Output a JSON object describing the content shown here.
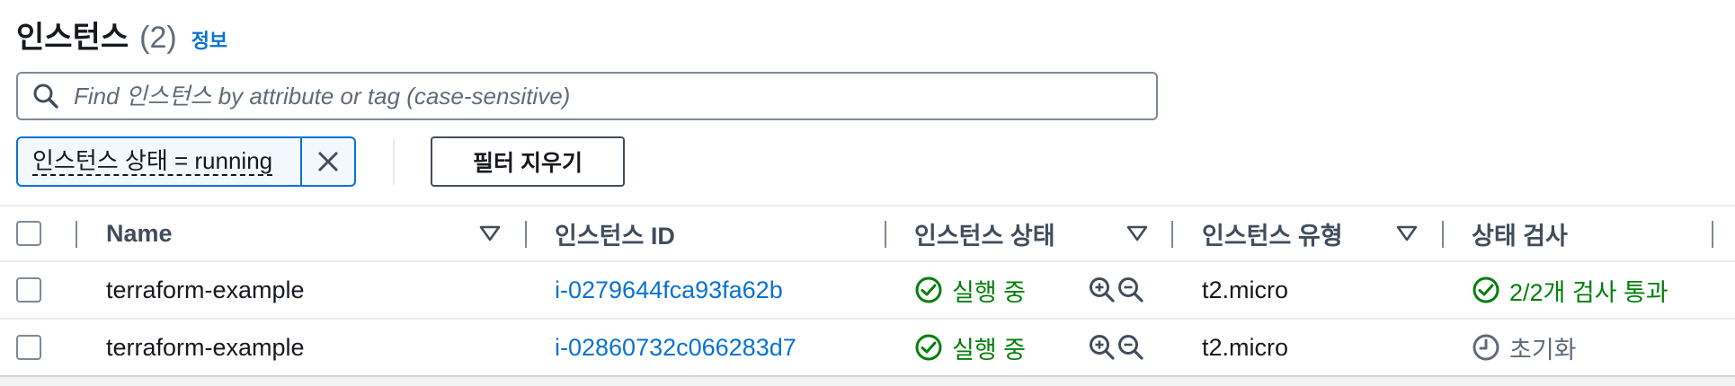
{
  "header": {
    "title": "인스턴스",
    "count": "(2)",
    "info_link": "정보"
  },
  "search": {
    "placeholder": "Find 인스턴스 by attribute or tag (case-sensitive)",
    "value": "",
    "icon": "search-icon"
  },
  "filter": {
    "token_label": "인스턴스 상태 = running",
    "dismiss_icon": "close-icon",
    "clear_button": "필터 지우기"
  },
  "table": {
    "columns": [
      {
        "label": "Name",
        "sortable": true
      },
      {
        "label": "인스턴스 ID",
        "sortable": false
      },
      {
        "label": "인스턴스 상태",
        "sortable": true
      },
      {
        "label": "인스턴스 유형",
        "sortable": true
      },
      {
        "label": "상태 검사",
        "sortable": false
      }
    ],
    "rows": [
      {
        "name": "terraform-example",
        "instance_id": "i-0279644fca93fa62b",
        "state": "실행 중",
        "state_status": "success",
        "type": "t2.micro",
        "check": "2/2개 검사 통과",
        "check_status": "success"
      },
      {
        "name": "terraform-example",
        "instance_id": "i-02860732c066283d7",
        "state": "실행 중",
        "state_status": "success",
        "type": "t2.micro",
        "check": "초기화",
        "check_status": "pending"
      }
    ]
  },
  "colors": {
    "link": "#0972d3",
    "success": "#037f0c",
    "muted": "#5f6b7a",
    "heading": "#414d5c",
    "border": "#e9ebed"
  }
}
